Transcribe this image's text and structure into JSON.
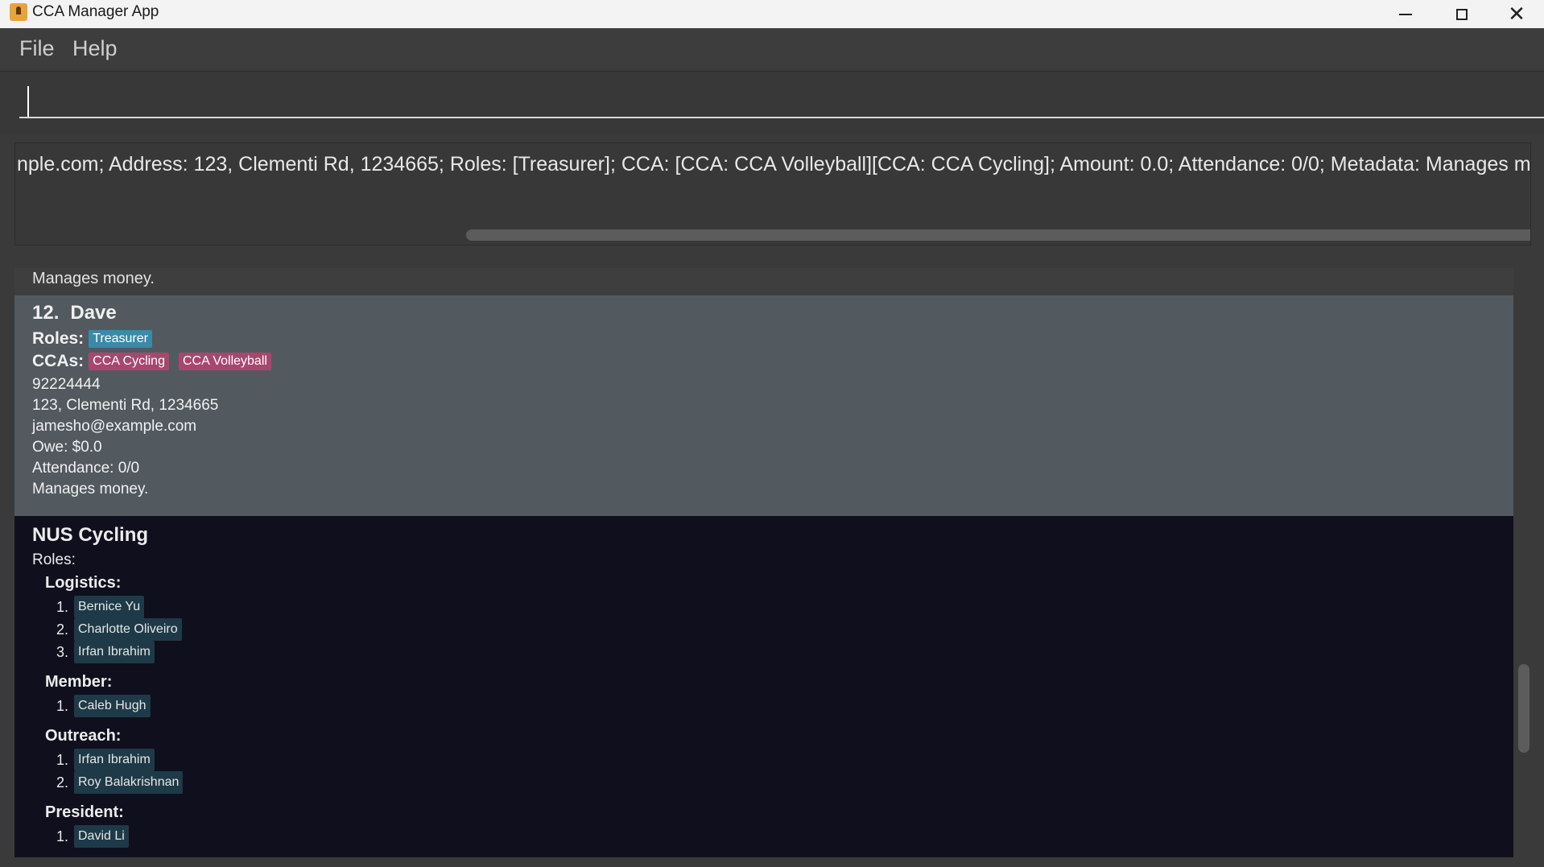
{
  "window": {
    "title": "CCA Manager App",
    "icon": "app-person-icon",
    "controls": [
      "minimize-icon",
      "maximize-icon",
      "close-icon"
    ],
    "close_glyph": "✕"
  },
  "menu": {
    "file": "File",
    "help": "Help"
  },
  "command": {
    "value": ""
  },
  "result": {
    "text": "nple.com; Address: 123, Clementi Rd, 1234665; Roles: [Treasurer]; CCA: [CCA: CCA Volleyball][CCA: CCA Cycling]; Amount: 0.0; Attendance: 0/0; Metadata: Manages money."
  },
  "list": {
    "prev_row_tail": "Manages money.",
    "person": {
      "index": "12.",
      "name": "Dave",
      "roles_label": "Roles:",
      "roles": [
        "Treasurer"
      ],
      "ccas_label": "CCAs:",
      "ccas": [
        "CCA Cycling",
        "CCA Volleyball"
      ],
      "phone": "92224444",
      "address": "123, Clementi Rd, 1234665",
      "email": "jamesho@example.com",
      "owe": "Owe: $0.0",
      "attendance": "Attendance: 0/0",
      "metadata": "Manages money."
    },
    "cca": {
      "name": "NUS Cycling",
      "roles_label": "Roles:",
      "groups": [
        {
          "role": "Logistics:",
          "members": [
            [
              "1.",
              "Bernice Yu"
            ],
            [
              "2.",
              "Charlotte Oliveiro"
            ],
            [
              "3.",
              "Irfan Ibrahim"
            ]
          ]
        },
        {
          "role": "Member:",
          "members": [
            [
              "1.",
              "Caleb Hugh"
            ]
          ]
        },
        {
          "role": "Outreach:",
          "members": [
            [
              "1.",
              "Irfan Ibrahim"
            ],
            [
              "2.",
              "Roy Balakrishnan"
            ]
          ]
        },
        {
          "role": "President:",
          "members": [
            [
              "1.",
              "David Li"
            ]
          ]
        }
      ]
    }
  },
  "colors": {
    "role_tag": "#3a8aa8",
    "cca_tag": "#a8476d",
    "selected_card": "#525a5f",
    "cca_card": "#0f0f1e"
  }
}
